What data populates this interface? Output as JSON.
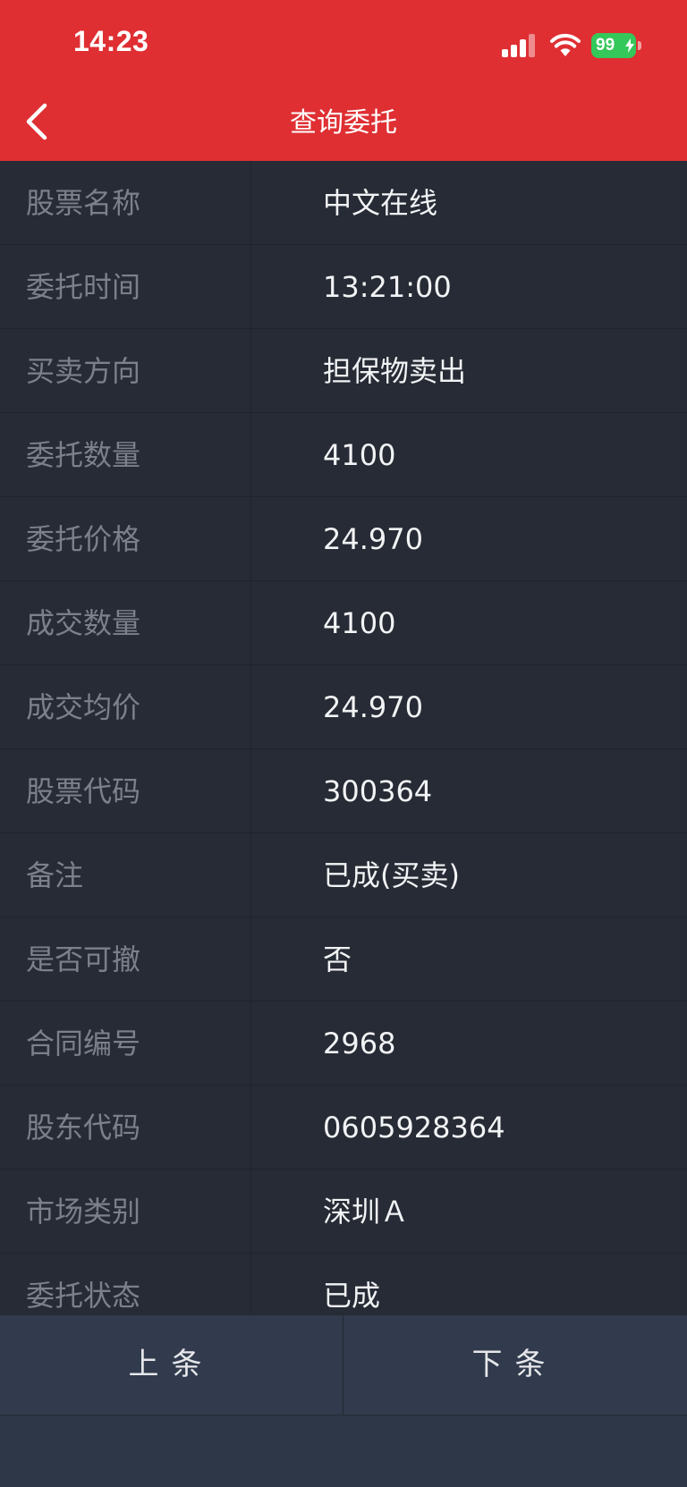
{
  "status_bar": {
    "time": "14:23",
    "battery_level": "99",
    "signal_icon": "cellular-signal-icon",
    "wifi_icon": "wifi-icon",
    "battery_color": "#34c759"
  },
  "nav": {
    "title": "查询委托",
    "back_icon": "chevron-left-icon",
    "background_color": "#df2f33"
  },
  "details": [
    {
      "label": "股票名称",
      "value": "中文在线"
    },
    {
      "label": "委托时间",
      "value": "13:21:00"
    },
    {
      "label": "买卖方向",
      "value": "担保物卖出"
    },
    {
      "label": "委托数量",
      "value": "4100"
    },
    {
      "label": "委托价格",
      "value": "24.970"
    },
    {
      "label": "成交数量",
      "value": "4100"
    },
    {
      "label": "成交均价",
      "value": "24.970"
    },
    {
      "label": "股票代码",
      "value": "300364"
    },
    {
      "label": "备注",
      "value": "已成(买卖)"
    },
    {
      "label": "是否可撤",
      "value": "否"
    },
    {
      "label": "合同编号",
      "value": "2968"
    },
    {
      "label": "股东代码",
      "value": "0605928364"
    },
    {
      "label": "市场类别",
      "value": "深圳Ａ"
    },
    {
      "label": "委托状态",
      "value": "已成"
    }
  ],
  "footer": {
    "prev_label": "上条",
    "next_label": "下条"
  }
}
